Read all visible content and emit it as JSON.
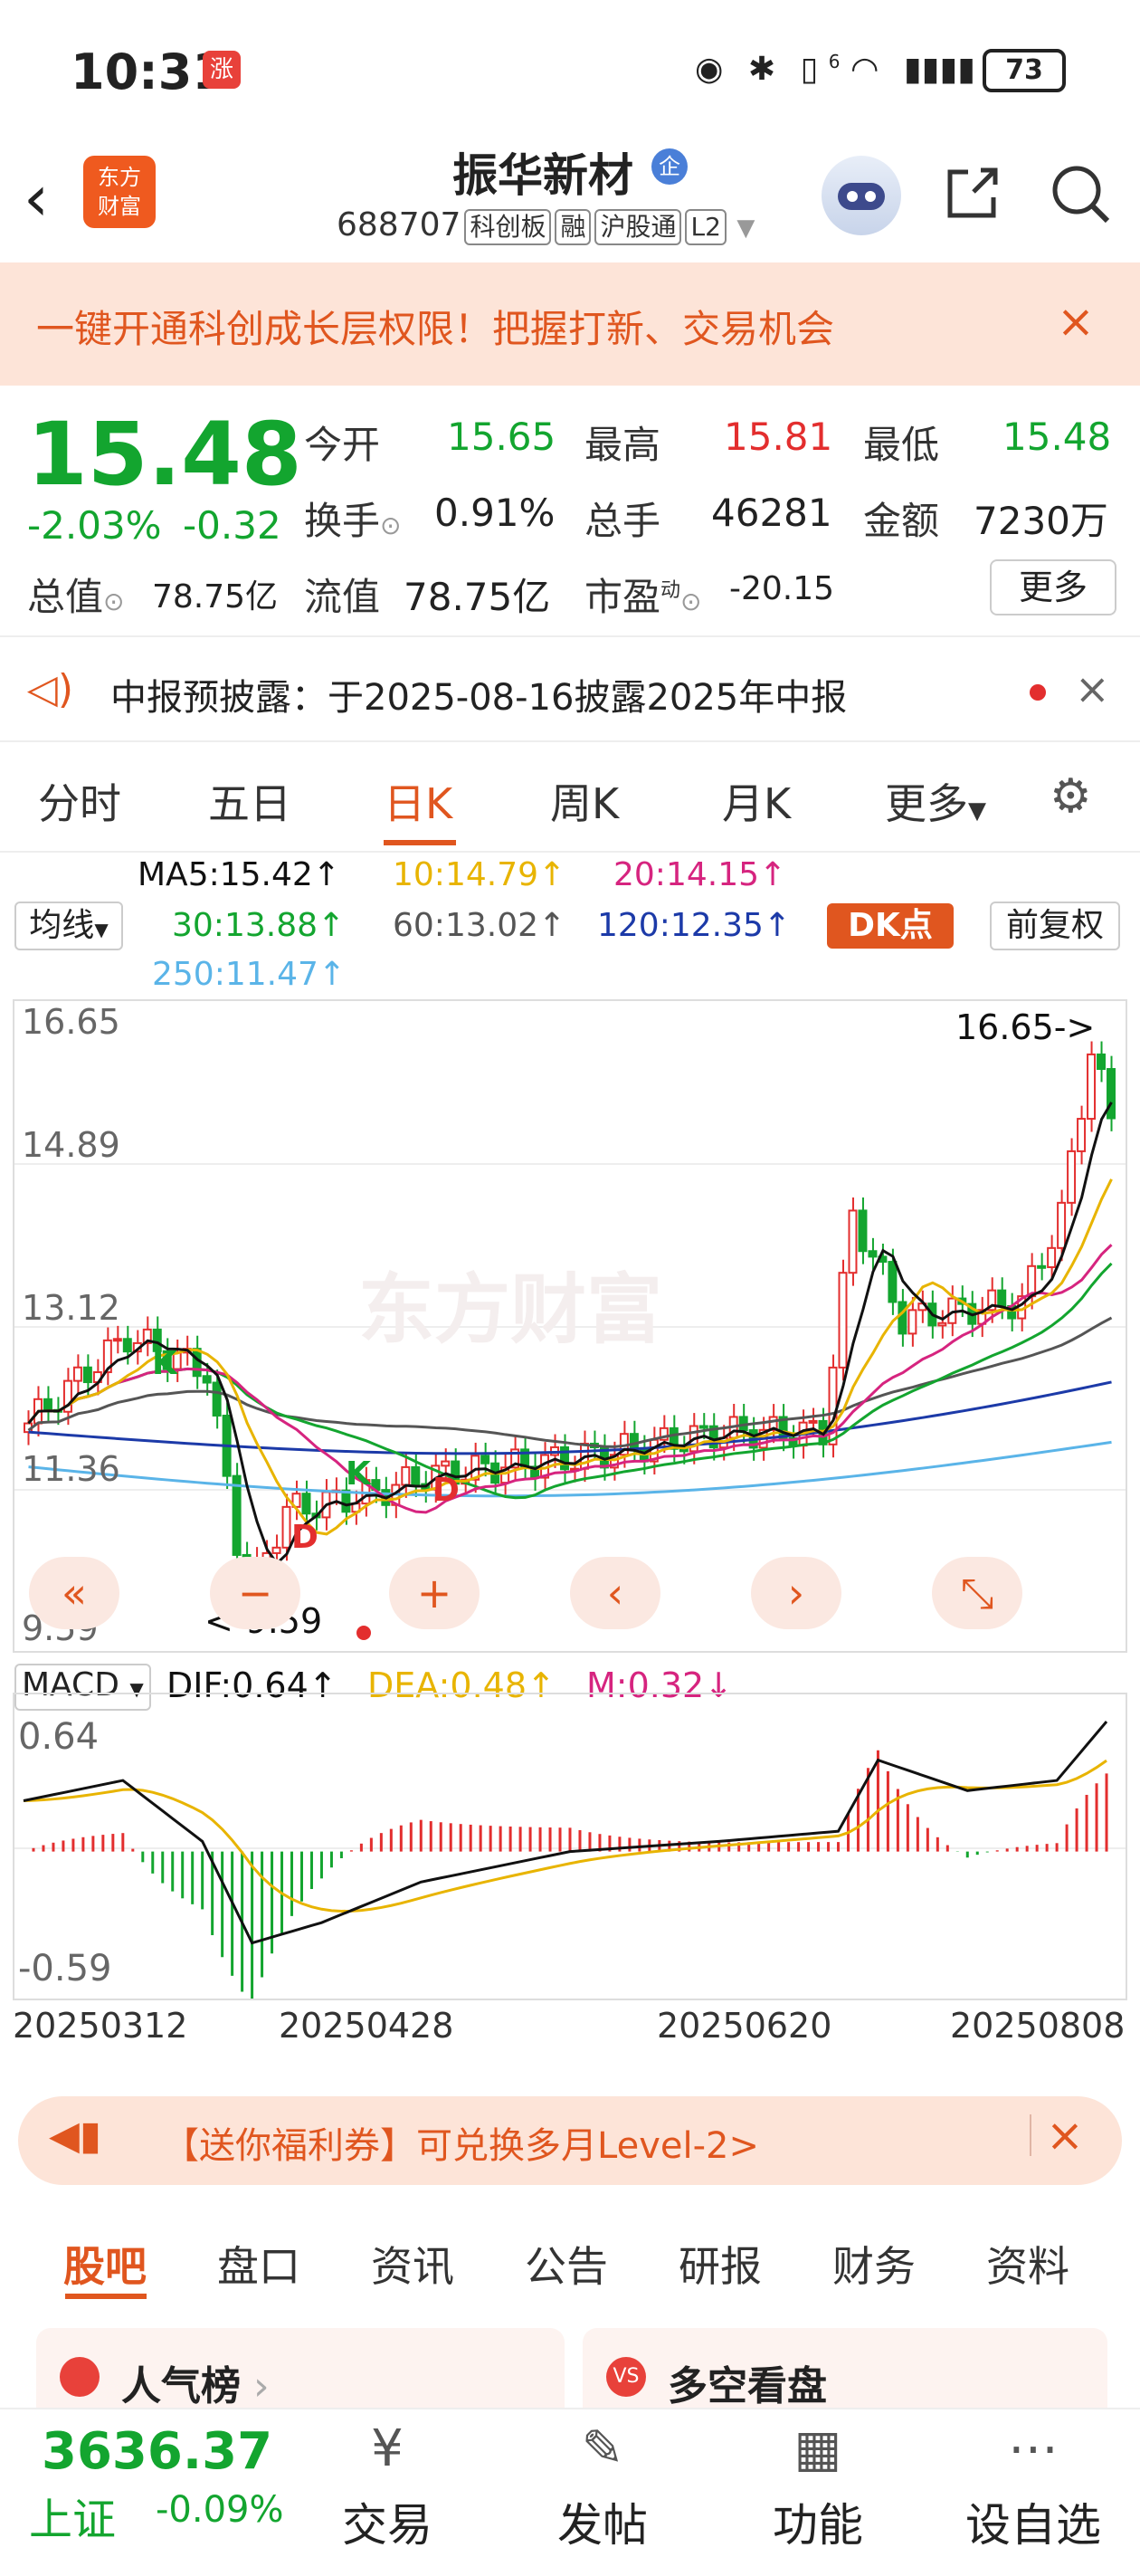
{
  "status_bar": {
    "time": "10:31",
    "badge": "涨",
    "signal_label": "6",
    "battery": "73"
  },
  "header": {
    "back_icon": "←",
    "app_logo_line1": "东方",
    "app_logo_line2": "财富",
    "stock_name": "振华新材",
    "qi_badge": "企",
    "stock_code": "688707",
    "tags": [
      "科创板",
      "融",
      "沪股通",
      "L2"
    ]
  },
  "promo": {
    "text": "一键开通科创成长层权限！把握打新、交易机会",
    "close": "×"
  },
  "quote": {
    "price": "15.48",
    "change_pct": "-2.03%",
    "change": "-0.32",
    "open_label": "今开",
    "open": "15.65",
    "high_label": "最高",
    "high": "15.81",
    "low_label": "最低",
    "low": "15.48",
    "turnover_label": "换手",
    "turnover": "0.91%",
    "volume_label": "总手",
    "volume": "46281",
    "amount_label": "金额",
    "amount": "7230万",
    "mktcap_label": "总值",
    "mktcap": "78.75亿",
    "float_label": "流值",
    "float_cap": "78.75亿",
    "pe_label": "市盈",
    "pe_sup": "动",
    "pe": "-20.15",
    "more": "更多"
  },
  "notice": {
    "text": "中报预披露：于2025-08-16披露2025年中报",
    "close": "×"
  },
  "kline_tabs": [
    "分时",
    "五日",
    "日K",
    "周K",
    "月K",
    "更多"
  ],
  "kline_active": 2,
  "ma": {
    "selector": "均线",
    "ma5": "MA5:15.42↑",
    "ma10": "10:14.79↑",
    "ma20": "20:14.15↑",
    "ma30": "30:13.88↑",
    "ma60": "60:13.02↑",
    "ma120": "120:12.35↑",
    "ma250": "250:11.47↑",
    "dk": "DK点",
    "fuquan": "前复权"
  },
  "colors": {
    "accent": "#e0561f",
    "up": "#e32e2e",
    "down": "#13a52f",
    "ma5": "#111111",
    "ma10": "#e8b400",
    "ma20": "#d6247f",
    "ma30": "#13a52f",
    "ma60": "#555555",
    "ma120": "#1c3aa8",
    "ma250": "#5ab4e8"
  },
  "kchart": {
    "y_labels": [
      "16.65",
      "14.89",
      "13.12",
      "11.36",
      "9.59"
    ],
    "max_marker": "16.65->",
    "min_marker": "<-9.59",
    "markers": [
      "K",
      "D",
      "K",
      "D"
    ],
    "watermark": "东方财富",
    "nav_buttons": [
      "«",
      "−",
      "+",
      "‹",
      "›",
      "⤡"
    ]
  },
  "macd": {
    "selector": "MACD",
    "dif": "DIF:0.64↑",
    "dea": "DEA:0.48↑",
    "m": "M:0.32↓",
    "y_top": "0.64",
    "y_bottom": "-0.59"
  },
  "dates": [
    "20250312",
    "20250428",
    "20250620",
    "20250808"
  ],
  "welfare": {
    "text": "【送你福利券】可兑换多月Level-2>",
    "close": "×"
  },
  "bottom_tabs": [
    "股吧",
    "盘口",
    "资讯",
    "公告",
    "研报",
    "财务",
    "资料"
  ],
  "bottom_tab_active": 0,
  "cards": [
    {
      "title": "人气榜"
    },
    {
      "title": "多空看盘"
    }
  ],
  "index": {
    "value": "3636.37",
    "name": "上证",
    "change": "-0.09%"
  },
  "bottom_nav": [
    {
      "label": "交易",
      "icon": "¥"
    },
    {
      "label": "发帖",
      "icon": "✎"
    },
    {
      "label": "功能",
      "icon": "▦"
    },
    {
      "label": "设自选",
      "icon": "⋯"
    }
  ]
}
